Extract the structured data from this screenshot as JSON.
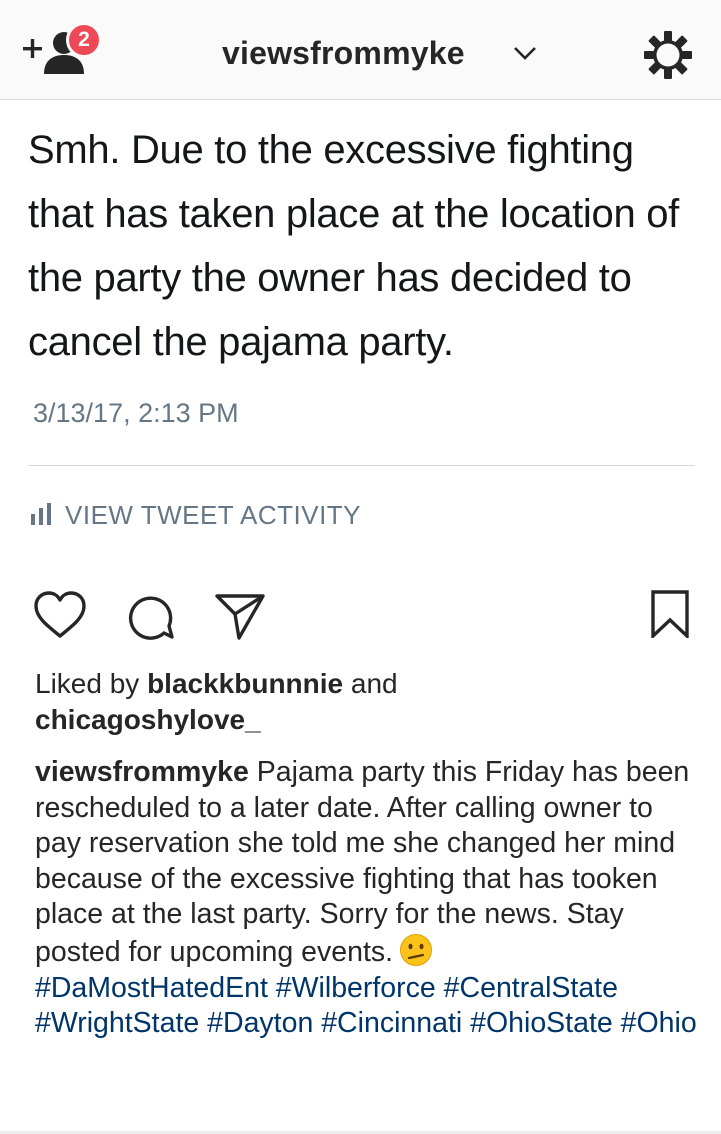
{
  "header": {
    "notification_count": "2",
    "username": "viewsfrommyke"
  },
  "tweet": {
    "text": "Smh. Due to the excessive fighting that has taken place at the location of the party the owner has decided to cancel the pajama party.",
    "timestamp": "3/13/17, 2:13 PM",
    "activity_label": "VIEW TWEET ACTIVITY"
  },
  "actions": {
    "icons": [
      "heart-icon",
      "comment-icon",
      "share-icon",
      "bookmark-icon"
    ]
  },
  "likes": {
    "prefix": "Liked by",
    "user1": "blackkbunnnie",
    "conjunction": "and",
    "user2": "chicagoshylove_"
  },
  "caption": {
    "username": "viewsfrommyke",
    "text": "Pajama party this Friday has been rescheduled to a later date. After calling owner to pay reservation she told me she changed her mind because of the excessive fighting that has tooken place at the last party. Sorry for the news. Stay posted for upcoming events.",
    "emoji": "confused-face-emoji",
    "hashtags": "#DaMostHatedEnt #Wilberforce #CentralState #WrightState #Dayton #Cincinnati #OhioState #Ohio"
  },
  "colors": {
    "badge": "#ed4956",
    "hashtag": "#003569",
    "meta_text": "#657786"
  }
}
